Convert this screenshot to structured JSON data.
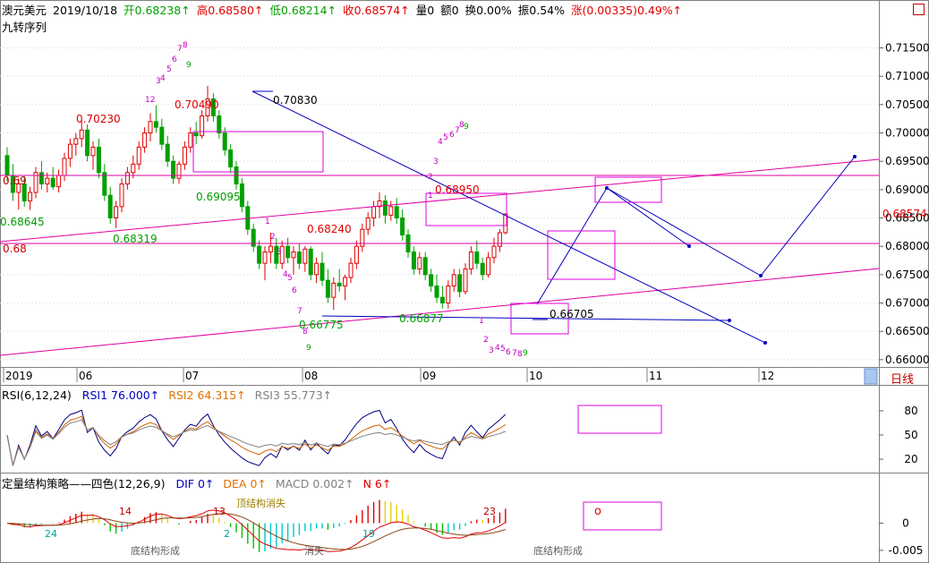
{
  "header": {
    "symbol": "澳元美元",
    "date": "2019/10/18",
    "open_label": "开",
    "open": "0.68238↑",
    "high_label": "高",
    "high": "0.68580↑",
    "low_label": "低",
    "low": "0.68214↑",
    "close_label": "收",
    "close": "0.68574↑",
    "volume": "量0",
    "amount": "额0",
    "turnover": "换0.00%",
    "amplitude": "振0.54%",
    "change": "涨(0.00335)0.49%↑",
    "indicator_name": "九转序列"
  },
  "colors": {
    "up": "#e00000",
    "down": "#00a000",
    "trend": "#0000c0",
    "channel": "#e000a0",
    "box": "#e000e0"
  },
  "period_tab": "日线",
  "chart_data": [
    {
      "type": "candlestick",
      "ylim": [
        0.6595,
        0.7165
      ],
      "y_ticks": [
        "0.71500",
        "0.71000",
        "0.70500",
        "0.70000",
        "0.69500",
        "0.69000",
        "0.68500",
        "0.68000",
        "0.67500",
        "0.67000",
        "0.66500",
        "0.66000"
      ],
      "y_tick_values": [
        0.715,
        0.71,
        0.705,
        0.7,
        0.695,
        0.69,
        0.685,
        0.68,
        0.675,
        0.67,
        0.665,
        0.66
      ],
      "x_labels": [
        "2019",
        "06",
        "07",
        "08",
        "09",
        "10",
        "11",
        "12"
      ],
      "last_price": "0.68574",
      "horizontal_levels": [
        {
          "value": 0.6925,
          "label": "0.69"
        },
        {
          "value": 0.6805,
          "label": "0.68"
        }
      ],
      "annotations": [
        "0.70230",
        "0.70490",
        "0.70830",
        "0.68645",
        "0.68319",
        "0.69095",
        "0.68240",
        "0.68950",
        "0.66775",
        "0.66877",
        "0.66705"
      ],
      "candles": [
        [
          0.696,
          0.6975,
          0.6915,
          0.6925
        ],
        [
          0.6925,
          0.6945,
          0.688,
          0.6895
        ],
        [
          0.6895,
          0.692,
          0.6865,
          0.691
        ],
        [
          0.691,
          0.6925,
          0.687,
          0.688
        ],
        [
          0.688,
          0.6905,
          0.6864,
          0.6895
        ],
        [
          0.6895,
          0.694,
          0.6885,
          0.693
        ],
        [
          0.693,
          0.695,
          0.69,
          0.691
        ],
        [
          0.691,
          0.693,
          0.6895,
          0.692
        ],
        [
          0.692,
          0.694,
          0.69,
          0.6905
        ],
        [
          0.6905,
          0.6935,
          0.6895,
          0.6925
        ],
        [
          0.6925,
          0.6965,
          0.6915,
          0.6955
        ],
        [
          0.6955,
          0.699,
          0.694,
          0.698
        ],
        [
          0.698,
          0.7,
          0.696,
          0.699
        ],
        [
          0.699,
          0.7023,
          0.6975,
          0.7005
        ],
        [
          0.7005,
          0.7015,
          0.695,
          0.696
        ],
        [
          0.696,
          0.6985,
          0.6935,
          0.6975
        ],
        [
          0.6975,
          0.699,
          0.692,
          0.693
        ],
        [
          0.693,
          0.6945,
          0.688,
          0.689
        ],
        [
          0.689,
          0.6905,
          0.684,
          0.685
        ],
        [
          0.685,
          0.688,
          0.6832,
          0.687
        ],
        [
          0.687,
          0.692,
          0.686,
          0.691
        ],
        [
          0.691,
          0.694,
          0.69,
          0.693
        ],
        [
          0.693,
          0.696,
          0.692,
          0.6945
        ],
        [
          0.6945,
          0.6985,
          0.6935,
          0.6975
        ],
        [
          0.6975,
          0.701,
          0.6965,
          0.7
        ],
        [
          0.7,
          0.7035,
          0.6985,
          0.702
        ],
        [
          0.702,
          0.7049,
          0.7,
          0.701
        ],
        [
          0.701,
          0.7025,
          0.697,
          0.698
        ],
        [
          0.698,
          0.6995,
          0.694,
          0.695
        ],
        [
          0.695,
          0.696,
          0.691,
          0.692
        ],
        [
          0.692,
          0.695,
          0.691,
          0.6945
        ],
        [
          0.6945,
          0.6985,
          0.6935,
          0.6975
        ],
        [
          0.6975,
          0.701,
          0.6965,
          0.7
        ],
        [
          0.7,
          0.702,
          0.698,
          0.6995
        ],
        [
          0.6995,
          0.704,
          0.699,
          0.703
        ],
        [
          0.703,
          0.7083,
          0.702,
          0.706
        ],
        [
          0.706,
          0.707,
          0.702,
          0.703
        ],
        [
          0.703,
          0.704,
          0.699,
          0.7
        ],
        [
          0.7,
          0.701,
          0.696,
          0.697
        ],
        [
          0.697,
          0.698,
          0.693,
          0.694
        ],
        [
          0.694,
          0.695,
          0.69,
          0.691
        ],
        [
          0.691,
          0.692,
          0.686,
          0.687
        ],
        [
          0.687,
          0.688,
          0.682,
          0.683
        ],
        [
          0.683,
          0.684,
          0.679,
          0.68
        ],
        [
          0.68,
          0.681,
          0.676,
          0.677
        ],
        [
          0.677,
          0.68,
          0.674,
          0.679
        ],
        [
          0.679,
          0.6824,
          0.677,
          0.68
        ],
        [
          0.68,
          0.6815,
          0.676,
          0.677
        ],
        [
          0.677,
          0.681,
          0.676,
          0.68
        ],
        [
          0.68,
          0.6815,
          0.677,
          0.678
        ],
        [
          0.678,
          0.68,
          0.675,
          0.679
        ],
        [
          0.679,
          0.6805,
          0.676,
          0.677
        ],
        [
          0.677,
          0.68,
          0.6755,
          0.6795
        ],
        [
          0.6795,
          0.68,
          0.674,
          0.675
        ],
        [
          0.675,
          0.678,
          0.6735,
          0.677
        ],
        [
          0.677,
          0.679,
          0.673,
          0.674
        ],
        [
          0.674,
          0.676,
          0.67,
          0.671
        ],
        [
          0.671,
          0.6745,
          0.6688,
          0.6735
        ],
        [
          0.6735,
          0.676,
          0.672,
          0.673
        ],
        [
          0.673,
          0.675,
          0.6705,
          0.6745
        ],
        [
          0.6745,
          0.678,
          0.6735,
          0.677
        ],
        [
          0.677,
          0.681,
          0.676,
          0.68
        ],
        [
          0.68,
          0.684,
          0.679,
          0.683
        ],
        [
          0.683,
          0.686,
          0.682,
          0.685
        ],
        [
          0.685,
          0.688,
          0.6835,
          0.687
        ],
        [
          0.687,
          0.6895,
          0.685,
          0.688
        ],
        [
          0.688,
          0.689,
          0.684,
          0.6855
        ],
        [
          0.6855,
          0.688,
          0.6845,
          0.687
        ],
        [
          0.687,
          0.6885,
          0.684,
          0.685
        ],
        [
          0.685,
          0.6865,
          0.681,
          0.682
        ],
        [
          0.682,
          0.683,
          0.678,
          0.679
        ],
        [
          0.679,
          0.68,
          0.675,
          0.676
        ],
        [
          0.676,
          0.679,
          0.675,
          0.678
        ],
        [
          0.678,
          0.679,
          0.674,
          0.675
        ],
        [
          0.675,
          0.676,
          0.672,
          0.673
        ],
        [
          0.673,
          0.675,
          0.67,
          0.671
        ],
        [
          0.671,
          0.673,
          0.669,
          0.67
        ],
        [
          0.67,
          0.674,
          0.669,
          0.673
        ],
        [
          0.673,
          0.676,
          0.672,
          0.675
        ],
        [
          0.675,
          0.676,
          0.671,
          0.672
        ],
        [
          0.672,
          0.677,
          0.6715,
          0.676
        ],
        [
          0.676,
          0.68,
          0.675,
          0.679
        ],
        [
          0.679,
          0.681,
          0.676,
          0.677
        ],
        [
          0.677,
          0.678,
          0.674,
          0.675
        ],
        [
          0.675,
          0.679,
          0.6745,
          0.678
        ],
        [
          0.678,
          0.6815,
          0.677,
          0.68
        ],
        [
          0.68,
          0.683,
          0.679,
          0.6824
        ],
        [
          0.6824,
          0.6858,
          0.6821,
          0.6857
        ]
      ]
    },
    {
      "type": "line",
      "title": "RSI(6,12,24)",
      "series": [
        {
          "name": "RSI1",
          "value": "76.000↑",
          "color": "#000080"
        },
        {
          "name": "RSI2",
          "value": "64.315↑",
          "color": "#d06000"
        },
        {
          "name": "RSI3",
          "value": "55.773↑",
          "color": "#808080"
        }
      ],
      "y_ticks": [
        "80",
        "50",
        "20"
      ],
      "y_tick_values": [
        80,
        50,
        20
      ],
      "ylim": [
        10,
        90
      ]
    },
    {
      "type": "bar",
      "title": "定量结构策略——四色(12,26,9)",
      "series": [
        {
          "name": "DIF",
          "value": "0↑",
          "color": "#0000c0"
        },
        {
          "name": "DEA",
          "value": "0↑",
          "color": "#e07000"
        },
        {
          "name": "MACD",
          "value": "0.002↑",
          "color": "#808080"
        },
        {
          "name": "N",
          "value": "6↑",
          "color": "#e00000"
        }
      ],
      "y_ticks": [
        "0",
        "-0.005"
      ],
      "y_tick_values": [
        0,
        -0.005
      ],
      "ylim": [
        -0.0065,
        0.006
      ],
      "labels": [
        "14",
        "24",
        "13",
        "2",
        "23",
        "19",
        "底结构形成",
        "顶结构消失",
        "消失",
        "底结构形成"
      ]
    }
  ]
}
